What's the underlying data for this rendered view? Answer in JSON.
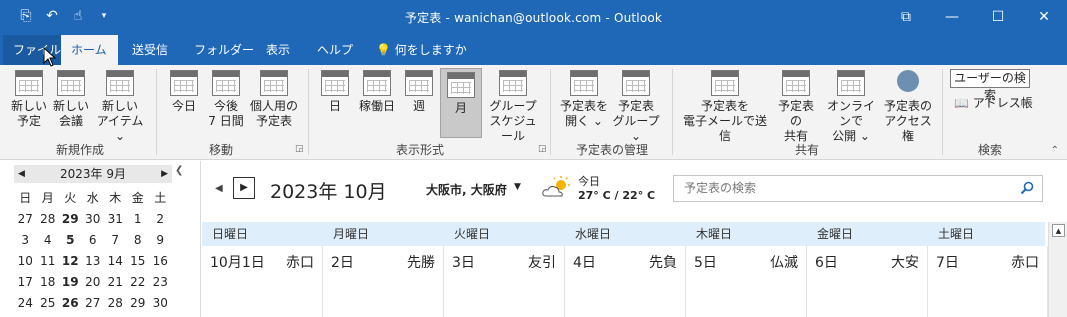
{
  "window": {
    "title": "予定表 - wanichan@outlook.com  -  Outlook",
    "controls": [
      "⧉",
      "—",
      "☐",
      "✕"
    ]
  },
  "qat": [
    "send-receive-icon",
    "undo-icon",
    "touch-mode-icon",
    "customize-icon"
  ],
  "tabs": [
    "ファイル",
    "ホーム",
    "送受信",
    "フォルダー",
    "表示",
    "ヘルプ",
    "何をしますか"
  ],
  "ribbon": {
    "groups": {
      "new": "新規作成",
      "goto": "移動",
      "arrange": "表示形式",
      "manage": "予定表の管理",
      "share": "共有",
      "find": "検索"
    },
    "buttons": {
      "new_appt": [
        "新しい",
        "予定"
      ],
      "new_meeting": [
        "新しい",
        "会議"
      ],
      "new_items": [
        "新しい",
        "アイテム ⌄"
      ],
      "today": "今日",
      "next7": [
        "今後",
        "7 日間"
      ],
      "personal": [
        "個人用の",
        "予定表"
      ],
      "day": "日",
      "workweek": "稼働日",
      "week": "週",
      "month": "月",
      "schedule": [
        "グループ",
        "スケジュール"
      ],
      "open_cal": [
        "予定表を",
        "開く ⌄"
      ],
      "cal_groups": [
        "予定表",
        "グループ ⌄"
      ],
      "email_cal": [
        "予定表を",
        "電子メールで送信"
      ],
      "share_cal": [
        "予定表の",
        "共有"
      ],
      "publish": [
        "オンラインで",
        "公開 ⌄"
      ],
      "permissions": [
        "予定表の",
        "アクセス権"
      ],
      "search_people": "ユーザーの検索",
      "address_book": "アドレス帳"
    }
  },
  "minical": {
    "title": "2023年 9月",
    "weekdays": [
      "日",
      "月",
      "火",
      "水",
      "木",
      "金",
      "土"
    ],
    "weeks": [
      [
        "27",
        "28",
        "29",
        "30",
        "31",
        "1",
        "2"
      ],
      [
        "3",
        "4",
        "5",
        "6",
        "7",
        "8",
        "9"
      ],
      [
        "10",
        "11",
        "12",
        "13",
        "14",
        "15",
        "16"
      ],
      [
        "17",
        "18",
        "19",
        "20",
        "21",
        "22",
        "23"
      ],
      [
        "24",
        "25",
        "26",
        "27",
        "28",
        "29",
        "30"
      ]
    ]
  },
  "calendar": {
    "title": "2023年 10月",
    "location": "大阪市, 大阪府",
    "weather_label": "今日",
    "weather_temp": "27° C / 22° C",
    "search_placeholder": "予定表の検索",
    "weekdays": [
      "日曜日",
      "月曜日",
      "火曜日",
      "水曜日",
      "木曜日",
      "金曜日",
      "土曜日"
    ],
    "days": [
      {
        "date": "10月1日",
        "rokuyo": "赤口"
      },
      {
        "date": "2日",
        "rokuyo": "先勝"
      },
      {
        "date": "3日",
        "rokuyo": "友引"
      },
      {
        "date": "4日",
        "rokuyo": "先負"
      },
      {
        "date": "5日",
        "rokuyo": "仏滅"
      },
      {
        "date": "6日",
        "rokuyo": "大安"
      },
      {
        "date": "7日",
        "rokuyo": "赤口"
      }
    ]
  }
}
